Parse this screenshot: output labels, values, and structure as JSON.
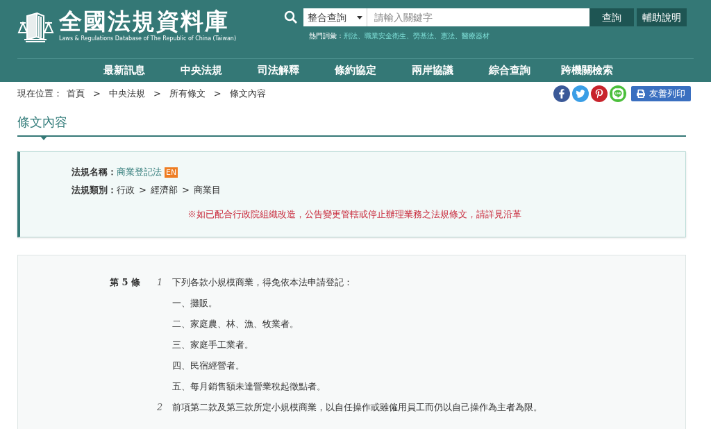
{
  "header": {
    "site_title": "全國法規資料庫",
    "site_subtitle": "Laws & Regulations Database of The Republic of China (Taiwan)",
    "search": {
      "scope": "整合查詢",
      "placeholder": "請輸入關鍵字",
      "submit": "查詢",
      "help": "輔助說明"
    },
    "hot_words": {
      "label": "熱門詞彙：",
      "separator": "、",
      "items": [
        "刑法",
        "職業安全衛生",
        "勞基法",
        "憲法",
        "醫療器材"
      ]
    }
  },
  "nav": [
    "最新訊息",
    "中央法規",
    "司法解釋",
    "條約協定",
    "兩岸協議",
    "綜合查詢",
    "跨機關檢索"
  ],
  "breadcrumb": {
    "label": "現在位置：",
    "separator": ">",
    "items": [
      "首頁",
      "中央法規",
      "所有條文",
      "條文內容"
    ]
  },
  "print_button": "友善列印",
  "page_title": "條文內容",
  "law_info": {
    "name_label": "法規名稱：",
    "name": "商業登記法",
    "badge": "EN",
    "category_label": "法規類別：",
    "category_separator": ">",
    "category": [
      "行政",
      "經濟部",
      "商業目"
    ],
    "notice": "※如已配合行政院組織改造，公告變更管轄或停止辦理業務之法規條文，請詳見沿革"
  },
  "article": {
    "number": "第 5 條",
    "paragraphs": [
      {
        "number": "1",
        "text": "下列各款小規模商業，得免依本法申請登記：",
        "items": [
          "一、攤販。",
          "二、家庭農、林、漁、牧業者。",
          "三、家庭手工業者。",
          "四、民宿經營者。",
          "五、每月銷售額未達營業稅起徵點者。"
        ]
      },
      {
        "number": "2",
        "text": "前項第二款及第三款所定小規模商業，以自任操作或雖僱用員工而仍以自己操作為主者為限。"
      }
    ]
  }
}
